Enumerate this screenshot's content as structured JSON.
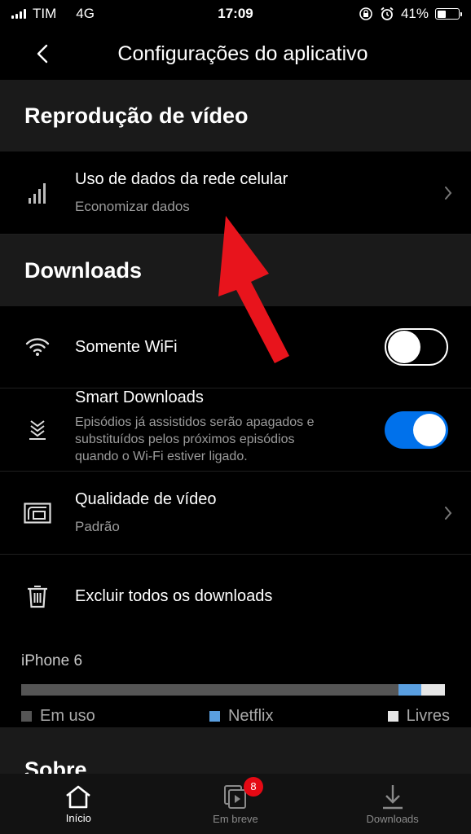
{
  "status_bar": {
    "carrier": "TIM",
    "network": "4G",
    "time": "17:09",
    "battery_percent": "41%",
    "battery_level": 0.41
  },
  "header": {
    "title": "Configurações do aplicativo"
  },
  "sections": {
    "video": {
      "title": "Reprodução de vídeo",
      "cellular": {
        "title": "Uso de dados da rede celular",
        "subtitle": "Economizar dados"
      }
    },
    "downloads": {
      "title": "Downloads",
      "wifi_only": {
        "title": "Somente WiFi",
        "enabled": false
      },
      "smart_downloads": {
        "title": "Smart Downloads",
        "description_line1": "Episódios já assistidos serão apagados e",
        "description_line2": "substituídos pelos próximos episódios",
        "description_line3": "quando o Wi-Fi estiver ligado.",
        "enabled": true
      },
      "video_quality": {
        "title": "Qualidade de vídeo",
        "subtitle": "Padrão"
      },
      "delete_all": {
        "title": "Excluir todos os downloads"
      }
    },
    "storage": {
      "device": "iPhone 6",
      "used_fraction": 0.89,
      "netflix_fraction": 0.055,
      "free_fraction": 0.055,
      "legend_used": "Em uso",
      "legend_netflix": "Netflix",
      "legend_free": "Livres"
    },
    "about": {
      "title": "Sobre"
    }
  },
  "tab_bar": {
    "home_label": "Início",
    "coming_soon_label": "Em breve",
    "coming_soon_badge": "8",
    "downloads_label": "Downloads"
  },
  "colors": {
    "accent": "#0071eb",
    "netflix_bar": "#5a9fe0",
    "badge": "#e50914",
    "annotation_arrow": "#e8141c"
  }
}
